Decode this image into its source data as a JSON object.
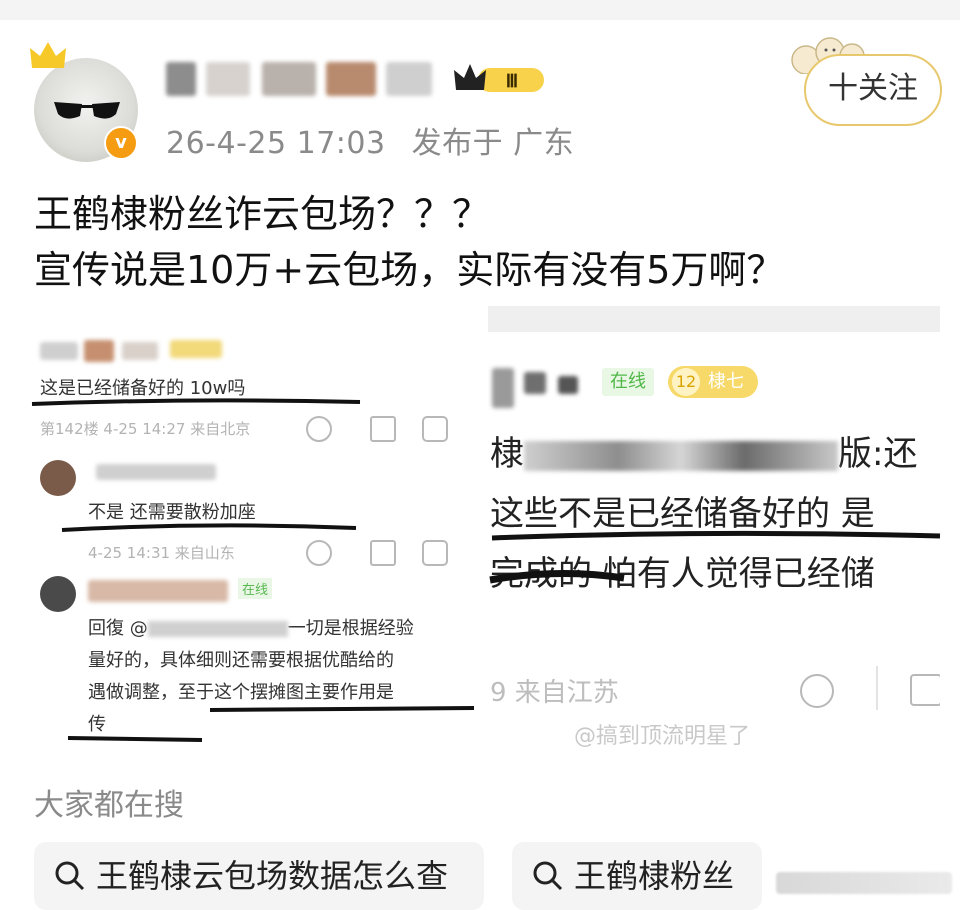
{
  "post": {
    "time": "26-4-25 17:03",
    "location": "发布于 广东",
    "follow_label": "十关注",
    "level_badge": "Ⅲ",
    "verified_mark": "v",
    "line1": "王鹤棣粉丝诈云包场？？？",
    "line2": "宣传说是10万+云包场，实际有没有5万啊？"
  },
  "left_screenshot": {
    "c1_text": "这是已经储备好的 10w吗",
    "c1_meta": "第142楼 4-25 14:27 来自北京",
    "c2_text": "不是 还需要散粉加座",
    "c2_meta": "4-25 14:31 来自山东",
    "c3_tag": "在线",
    "c3_prefix": "回復 @",
    "c3_suffix": "一切是根据经验",
    "c3_line2": "量好的，具体细则还需要根据优酷给的",
    "c3_line3": "遇做调整，至于这个摆摊图主要作用是",
    "c3_line4": "传"
  },
  "right_screenshot": {
    "online": "在线",
    "level": "12",
    "level_name": "棣七",
    "line1_start": "棣",
    "line1_end": "版:还",
    "line2": "这些不是已经储备好的 是",
    "line3": "完成的 怕有人觉得已经储",
    "meta": "9 来自江苏",
    "watermark": "@搞到顶流明星了"
  },
  "search": {
    "title": "大家都在搜",
    "chips": [
      "王鹤棣云包场数据怎么查",
      "王鹤棣粉丝"
    ]
  },
  "colors": {
    "accent_gold": "#e7c86d",
    "badge_orange": "#f59c12",
    "online_green": "#50b848"
  }
}
